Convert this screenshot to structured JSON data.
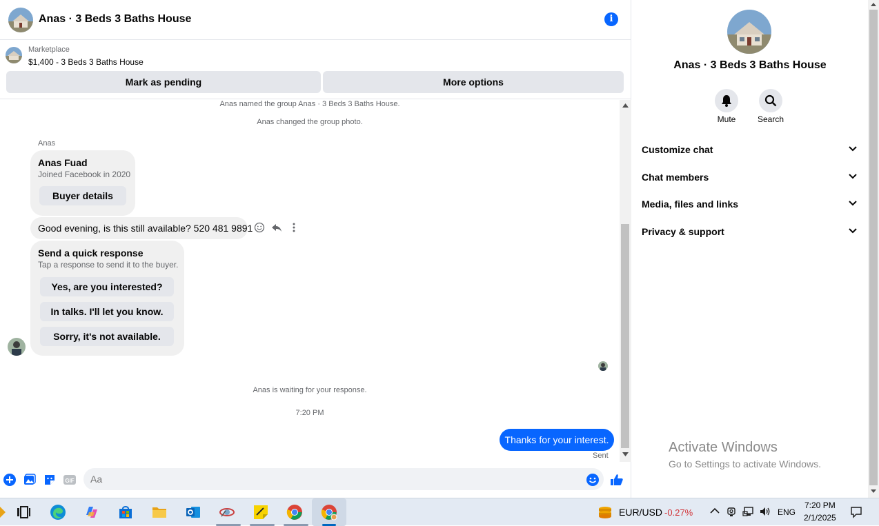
{
  "header": {
    "title": "Anas · 3 Beds 3 Baths House",
    "info_icon": "i"
  },
  "marketplace": {
    "label": "Marketplace",
    "listing": "$1,400 - 3 Beds 3 Baths House",
    "buttons": {
      "mark_pending": "Mark as pending",
      "more_options": "More options"
    }
  },
  "chat": {
    "system_messages": [
      "Anas named the group Anas · 3 Beds 3 Baths House.",
      "Anas changed the group photo."
    ],
    "sender_name": "Anas",
    "buyer_card": {
      "name": "Anas Fuad",
      "joined": "Joined Facebook in 2020",
      "button": "Buyer details"
    },
    "incoming_message": "Good evening, is this still available? 520 481 9891",
    "quick_response": {
      "title": "Send a quick response",
      "subtitle": "Tap a response to send it to the buyer.",
      "options": [
        "Yes, are you interested?",
        "In talks. I'll let you know.",
        "Sorry, it's not available."
      ]
    },
    "waiting_text": "Anas is waiting for your response.",
    "timestamp": "7:20 PM",
    "outgoing_message": "Thanks for your interest.",
    "sent_label": "Sent"
  },
  "composer": {
    "placeholder": "Aa"
  },
  "details": {
    "title": "Anas · 3 Beds 3 Baths House",
    "actions": [
      "Mute",
      "Search"
    ],
    "sections": [
      "Customize chat",
      "Chat members",
      "Media, files and links",
      "Privacy & support"
    ]
  },
  "watermark": {
    "line1": "Activate Windows",
    "line2": "Go to Settings to activate Windows."
  },
  "taskbar": {
    "ticker": {
      "pair": "EUR/USD",
      "change": "-0.27%"
    },
    "lang": "ENG",
    "time": "7:20 PM",
    "date": "2/1/2025"
  },
  "colors": {
    "accent": "#0866ff",
    "negative": "#d13438"
  }
}
